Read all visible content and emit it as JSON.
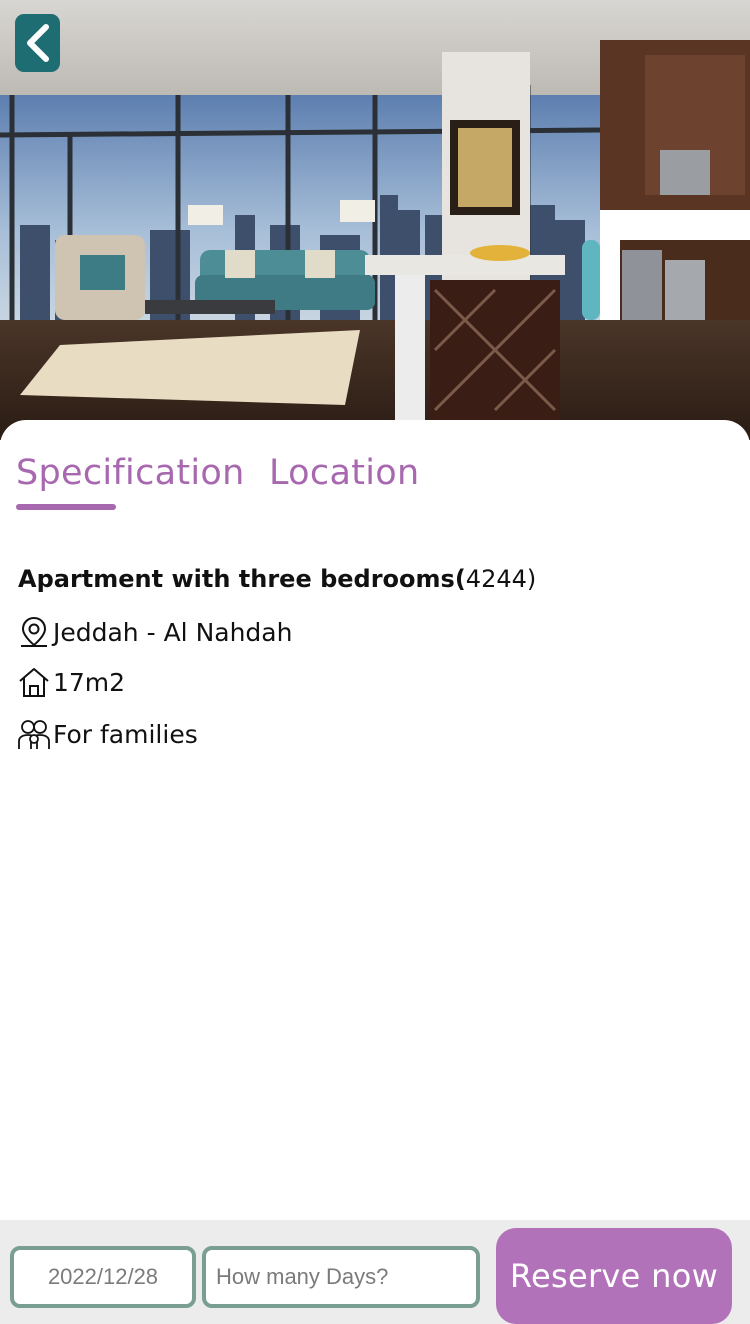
{
  "header": {
    "back_icon": "chevron-left-icon",
    "hero_image": "apartment-living-room-photo"
  },
  "tabs": [
    {
      "label": "Specification",
      "active": true
    },
    {
      "label": "Location",
      "active": false
    }
  ],
  "listing": {
    "title": "Apartment with three bedrooms(",
    "id_number": "4244",
    "id_close": ")",
    "location": "Jeddah - Al Nahdah",
    "location_icon": "map-pin-icon",
    "area": "17m2",
    "area_icon": "home-icon",
    "audience": "For families",
    "audience_icon": "family-icon"
  },
  "booking": {
    "date_value": "2022/12/28",
    "days_placeholder": "How many Days?",
    "reserve_label": "Reserve now"
  },
  "colors": {
    "accent": "#a868b0",
    "button": "#b172b9",
    "back_button": "#1d6d73",
    "field_border": "#7a9e92",
    "bar_background": "#ececec"
  }
}
